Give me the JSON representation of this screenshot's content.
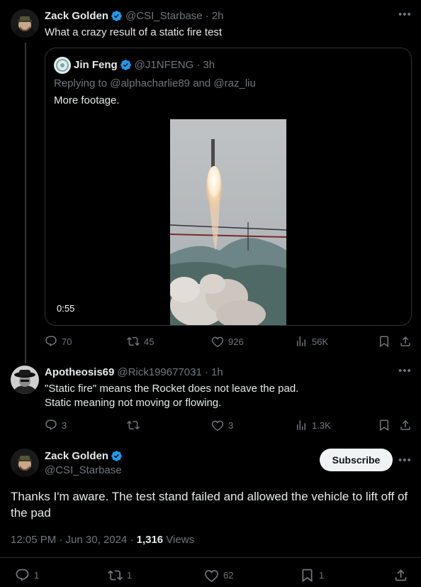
{
  "parent_tweet": {
    "author_name": "Zack Golden",
    "handle": "@CSI_Starbase",
    "time": "· 2h",
    "text": "What a crazy result of a static fire test",
    "quote": {
      "author_name": "Jin Feng",
      "handle": "@J1NFENG",
      "time": "· 3h",
      "reply_prefix": "Replying to",
      "reply_user1": "@alphacharlie89",
      "reply_and": "and",
      "reply_user2": "@raz_liu",
      "text": "More footage.",
      "video_duration": "0:55"
    },
    "stats": {
      "replies": "70",
      "reposts": "45",
      "likes": "926",
      "views": "56K"
    }
  },
  "reply_tweet": {
    "author_name": "Apotheosis69",
    "handle": "@Rick199677031",
    "time": "· 1h",
    "line1": "\"Static fire\" means the Rocket does not leave the pad.",
    "line2": "Static meaning not moving or flowing.",
    "stats": {
      "replies": "3",
      "reposts": "",
      "likes": "3",
      "views": "1.3K"
    }
  },
  "main_tweet": {
    "author_name": "Zack Golden",
    "handle": "@CSI_Starbase",
    "subscribe_label": "Subscribe",
    "text": "Thanks I'm aware. The test stand failed and allowed the vehicle to lift off of the pad",
    "timestamp": "12:05 PM · Jun 30, 2024 ·",
    "view_count": "1,316",
    "views_label": "Views",
    "stats": {
      "replies": "1",
      "reposts": "1",
      "likes": "62",
      "bookmarks": "1"
    }
  },
  "colors": {
    "background": "#000000",
    "text": "#e7e9ea",
    "muted": "#71767b",
    "verified": "#1d9bf0",
    "border": "#2f3336"
  },
  "icons": [
    "more-icon",
    "verified-icon",
    "reply-icon",
    "repost-icon",
    "like-icon",
    "views-icon",
    "bookmark-icon",
    "share-icon"
  ]
}
